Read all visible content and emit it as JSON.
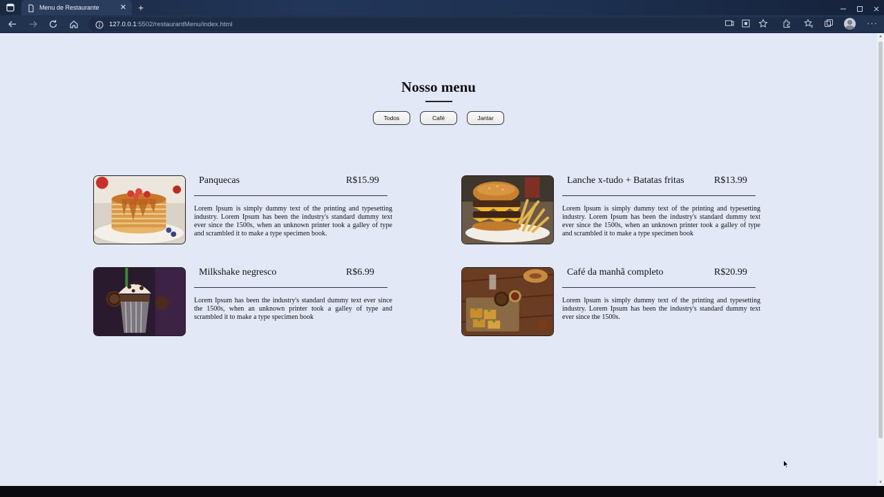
{
  "browser": {
    "tab_title": "Menu de Restaurante",
    "url_host": "127.0.0.1",
    "url_path": ":5502/restaurantMenu/index.html",
    "new_tab_label": "+",
    "tab_close_label": "✕",
    "more_label": "···"
  },
  "page": {
    "title": "Nosso menu",
    "filters": [
      "Todos",
      "Café",
      "Jantar"
    ]
  },
  "menu_items": [
    {
      "name": "Panquecas",
      "price": "R$15.99",
      "description": "Lorem Ipsum is simply dummy text of the printing and typesetting industry. Lorem Ipsum has been the industry's standard dummy text ever since the 1500s, when an unknown printer took a galley of type and scrambled it to make a type specimen book."
    },
    {
      "name": "Lanche x-tudo + Batatas fritas",
      "price": "R$13.99",
      "description": "Lorem Ipsum is simply dummy text of the printing and typesetting industry. Lorem Ipsum has been the industry's standard dummy text ever since the 1500s, when an unknown printer took a galley of type and scrambled it to make a type specimen book"
    },
    {
      "name": "Milkshake negresco",
      "price": "R$6.99",
      "description": "Lorem Ipsum has been the industry's standard dummy text ever since the 1500s, when an unknown printer took a galley of type and scrambled it to make a type specimen book"
    },
    {
      "name": "Café da manhã completo",
      "price": "R$20.99",
      "description": "Lorem Ipsum is simply dummy text of the printing and typesetting industry. Lorem Ipsum has been the industry's standard dummy text ever since the 1500s."
    }
  ],
  "colors": {
    "page_background": "#e2e8f6",
    "browser_chrome": "#223350",
    "text": "#111111"
  }
}
